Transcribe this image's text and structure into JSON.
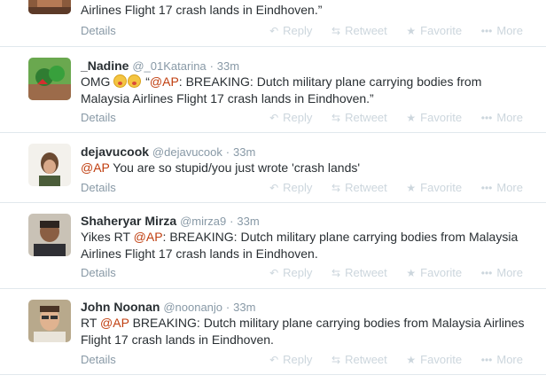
{
  "tweets": [
    {
      "fullname": "",
      "screen": "",
      "time": "",
      "text_tail": "Airlines Flight 17 crash lands in Eindhoven.”",
      "details": "Details",
      "reply": "Reply",
      "retweet": "Retweet",
      "favorite": "Favorite",
      "more": "More"
    },
    {
      "fullname": "_Nadine",
      "screen": "@_01Katarina",
      "dot": "·",
      "time": "33m",
      "text_pre": "OMG ",
      "text_quote_open": " “",
      "mention": "@AP",
      "text_body": ": BREAKING: Dutch military plane carrying bodies from Malaysia Airlines Flight 17 crash lands in Eindhoven.”",
      "details": "Details",
      "reply": "Reply",
      "retweet": "Retweet",
      "favorite": "Favorite",
      "more": "More"
    },
    {
      "fullname": "dejavucook",
      "screen": "@dejavucook",
      "dot": "·",
      "time": "33m",
      "mention": "@AP",
      "text_body": " You are so stupid/you just wrote 'crash lands'",
      "details": "Details",
      "reply": "Reply",
      "retweet": "Retweet",
      "favorite": "Favorite",
      "more": "More"
    },
    {
      "fullname": "Shaheryar Mirza",
      "screen": "@mirza9",
      "dot": "·",
      "time": "33m",
      "text_pre": "Yikes RT ",
      "mention": "@AP",
      "text_body": ": BREAKING: Dutch military plane carrying bodies from Malaysia Airlines Flight 17 crash lands in Eindhoven.",
      "details": "Details",
      "reply": "Reply",
      "retweet": "Retweet",
      "favorite": "Favorite",
      "more": "More"
    },
    {
      "fullname": "John Noonan",
      "screen": "@noonanjo",
      "dot": "·",
      "time": "33m",
      "text_pre": "RT ",
      "mention": "@AP",
      "text_body": " BREAKING: Dutch military plane carrying bodies from Malaysia Airlines Flight 17 crash lands in Eindhoven.",
      "details": "Details",
      "reply": "Reply",
      "retweet": "Retweet",
      "favorite": "Favorite",
      "more": "More"
    }
  ],
  "icons": {
    "reply": "reply-icon",
    "retweet": "retweet-icon",
    "favorite": "star-icon",
    "more": "more-dots-icon"
  },
  "colors": {
    "mention": "#c03e0f",
    "muted": "#8899a6",
    "action": "#ccd6dd",
    "divider": "#e1e8ed"
  }
}
